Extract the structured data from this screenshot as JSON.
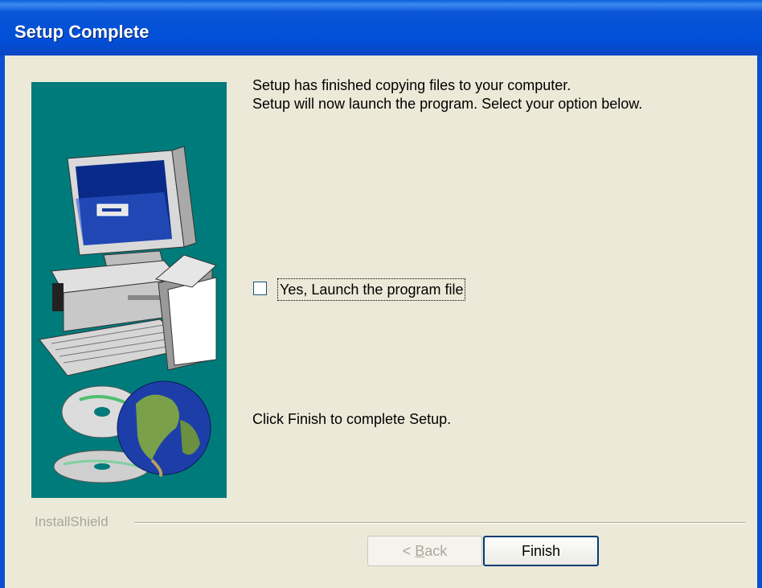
{
  "window": {
    "title": "Setup Complete"
  },
  "message": {
    "line1": "Setup has finished copying files to your computer.",
    "line2": "Setup will now launch the program. Select your option below."
  },
  "launch_option": {
    "label": "Yes, Launch the program file",
    "checked": false
  },
  "finish_message": "Click Finish to complete Setup.",
  "brand": "InstallShield",
  "buttons": {
    "back": {
      "prefix": "< ",
      "mnemonic": "B",
      "rest": "ack",
      "enabled": false
    },
    "finish": {
      "label": "Finish"
    }
  },
  "colors": {
    "titlebar": "#0050d8",
    "dialog_bg": "#ece9d8",
    "graphic_bg": "#007b7b"
  },
  "icons": [
    "computer-illustration",
    "cd-disc-icon",
    "globe-icon"
  ]
}
